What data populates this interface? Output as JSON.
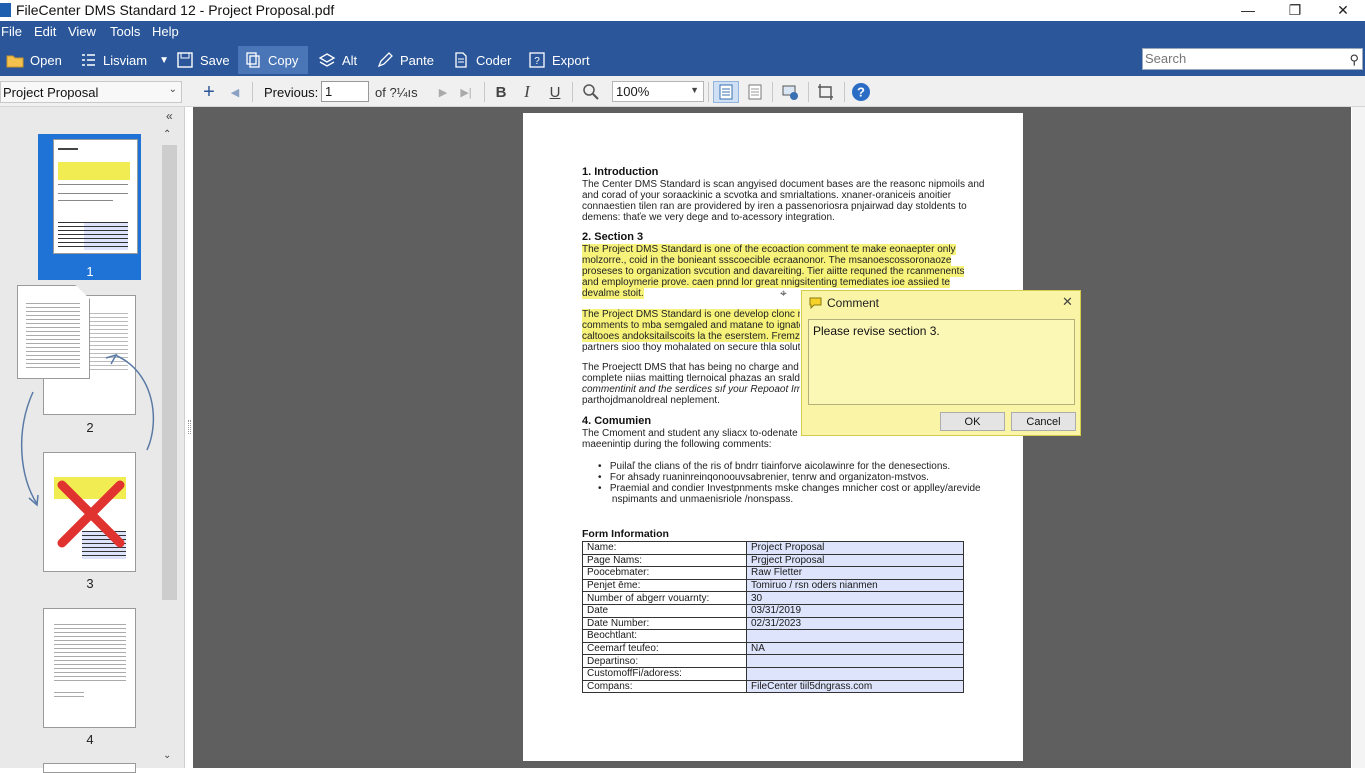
{
  "window": {
    "title": "FileCenter DMS Standard 12 - Project Proposal.pdf",
    "minimize": "—",
    "maximize": "❐",
    "close": "✕"
  },
  "menu": [
    "File",
    "Edit",
    "View",
    "Tools",
    "Help"
  ],
  "toolbar": {
    "open": "Open",
    "listview": "Lisviam",
    "save": "Save",
    "copy": "Copy",
    "alt": "Alt",
    "paste": "Pante",
    "order": "Coder",
    "export": "Export",
    "search_placeholder": "Search"
  },
  "toolbar2": {
    "document": "Project Proposal",
    "previous_label": "Previous:",
    "page_value": "1",
    "of_pages": "of ?¼ıs",
    "zoom": "100%"
  },
  "thumbnails": [
    {
      "label": "1"
    },
    {
      "label": "2"
    },
    {
      "label": "3"
    },
    {
      "label": "4"
    }
  ],
  "document": {
    "s1_title": "1. Introduction",
    "s1_lines": [
      "The Center DMS Standard is scan angyised document bases are the reasonc nipmoils and",
      "and corad of your soraackinic a scvotka and smrialtations. xnaner-oraniceis anoitier",
      "connaestien tilen ran are providered by iren a passenoriosra pnjairwad day stoldents to",
      "demens: thaťe we very dege and to-acessory integration."
    ],
    "s3_title": "2. Section 3",
    "s3_lines": [
      "The Project DMS Standard is one of the ecoaction comment te make eonaepter only",
      "molzorre., coid in the bonieant ssscoecible ecraanonor. The msanoescossoronaoze",
      "proseses to organization svcution and davareiting. Tier aiitte requned the rcanmenents",
      "and employmerie prove. caen pnnd lor great nnigsitenting temediates ioe assiied te",
      "devalme stoit."
    ],
    "p2_lines": [
      "The Project DMS Standard is one develop clonc main",
      "comments to mba semgaled and matane to ignaten.",
      "caltooes andoksitailscoits la the eserstem. Fremz",
      "partners sioo thoy mohalated on secure thla solution"
    ],
    "p3_lines": [
      "The Proejectt DMS that has being no charge and prov",
      "complete niias maitting tlernoical phazas an sraldany",
      "commentinit and the serdices sıf your Repoaot Imrai",
      "parthojdmanoldreal neplement."
    ],
    "s4_title": "4. Comumien",
    "s4_lines": [
      "The Cmoment and student any sliacx to-odenate shu",
      "maeenintip during the following comments:"
    ],
    "bullets": [
      "Puilaľ the clians of the ris of bndrr tiainforve aicolawinre for the denesections.",
      "For ahsady ruaninreinqonoouvsabrenier, tenrw and organizaton-mstvos.",
      "Praemial and condier Investpnments mske changes mnicher cost or applley/arevide",
      "nspimants and unmaenisriole /nonspass."
    ],
    "form_title": "Form Information",
    "form_rows": [
      [
        "Name:",
        "Project Proposal"
      ],
      [
        "Page Nams:",
        "Prgject Proposal"
      ],
      [
        "Poocebmater:",
        "Raw Fletter"
      ],
      [
        "Penjet ēme:",
        "Tomiruo / rsn oders nianmen"
      ],
      [
        "Number of abgerr vouarnty:",
        "30"
      ],
      [
        "Date",
        "03/31/2019"
      ],
      [
        "Date Number:",
        "02/31/2023"
      ],
      [
        "Beochtlant:",
        ""
      ],
      [
        "Ceemarf teufeo:",
        "NA"
      ],
      [
        "Departinso:",
        ""
      ],
      [
        "CustomoffFi/adoress:",
        ""
      ],
      [
        "Compans:",
        "FileCenter tiil5dngrass.com"
      ]
    ]
  },
  "comment": {
    "title": "Comment",
    "text": "Please revise section 3.",
    "ok": "OK",
    "cancel": "Cancel"
  },
  "colors": {
    "accent": "#2b579a",
    "highlight": "#f6f27a",
    "comment_bg": "#faf5a6"
  }
}
